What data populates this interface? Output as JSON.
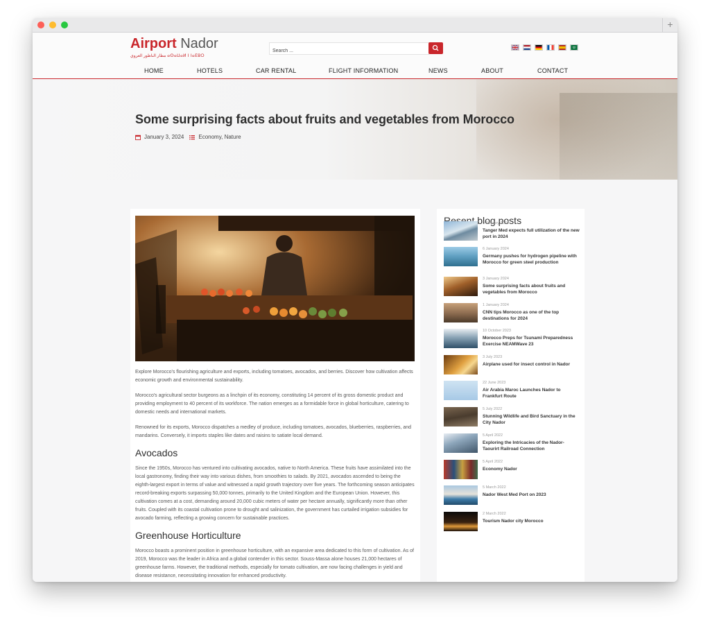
{
  "logo": {
    "part1": "Airport",
    "part2": "Nador",
    "tagline": "مطار الناظور العروي  ⴰⵙⴰⵡⴰⵍ ⵏ ⵏⴰⴹⵓⵔ"
  },
  "search": {
    "placeholder": "Search ..."
  },
  "languages": [
    "English",
    "Dutch",
    "German",
    "French",
    "Spanish",
    "Arabic"
  ],
  "nav": [
    "HOME",
    "HOTELS",
    "CAR RENTAL",
    "FLIGHT INFORMATION",
    "NEWS",
    "ABOUT",
    "CONTACT"
  ],
  "post": {
    "title": "Some surprising facts about fruits and vegetables from Morocco",
    "date": "January 3, 2024",
    "categories": "Economy, Nature",
    "paragraphs": [
      "Explore Morocco's flourishing agriculture and exports, including tomatoes, avocados, and berries. Discover how cultivation affects economic growth and environmental sustainability.",
      "Morocco's agricultural sector burgeons as a linchpin of its economy, constituting 14 percent of its gross domestic product and providing employment to 40 percent of its workforce. The nation emerges as a formidable force in global horticulture, catering to domestic needs and international markets.",
      "Renowned for its exports, Morocco dispatches a medley of produce, including tomatoes, avocados, blueberries, raspberries, and mandarins. Conversely, it imports staples like dates and raisins to satiate local demand."
    ],
    "h_avocados": "Avocados",
    "p_avocados": "Since the 1950s, Morocco has ventured into cultivating avocados, native to North America. These fruits have assimilated into the local gastronomy, finding their way into various dishes, from smoothies to salads. By 2021, avocados ascended to being the eighth-largest export in terms of value and witnessed a rapid growth trajectory over five years. The forthcoming season anticipates record-breaking exports surpassing 50,000 tonnes, primarily to the United Kingdom and the European Union. However, this cultivation comes at a cost, demanding around 20,000 cubic meters of water per hectare annually, significantly more than other fruits. Coupled with its coastal cultivation prone to drought and salinization, the government has curtailed irrigation subsidies for avocado farming, reflecting a growing concern for sustainable practices.",
    "h_greenhouse": "Greenhouse Horticulture",
    "p_greenhouse": "Morocco boasts a prominent position in greenhouse horticulture, with an expansive area dedicated to this form of cultivation. As of 2019, Morocco was the leader in Africa and a global contender in this sector. Souss-Massa alone houses 21,000 hectares of greenhouse farms. However, the traditional methods, especially for tomato cultivation, are now facing challenges in yield and disease resistance, necessitating innovation for enhanced productivity."
  },
  "sidebar": {
    "title": "Resent blog posts",
    "posts": [
      {
        "date": "9 January 2024",
        "title": "Tanger Med expects full utilization of the new port in 2024",
        "thumb": "port"
      },
      {
        "date": "6 January 2024",
        "title": "Germany pushes for hydrogen pipeline with Morocco for green steel production",
        "thumb": "pipeline"
      },
      {
        "date": "3 January 2024",
        "title": "Some surprising facts about fruits and vegetables from Morocco",
        "thumb": "market"
      },
      {
        "date": "1 January 2024",
        "title": "CNN tips Morocco as one of the top destinations for 2024",
        "thumb": "city"
      },
      {
        "date": "10 October 2023",
        "title": "Morocco Preps for Tsunami Preparedness Exercise NEAMWave 23",
        "thumb": "waves"
      },
      {
        "date": "3 July 2023",
        "title": "Airplane used for insect control in Nador",
        "thumb": "plane-gold"
      },
      {
        "date": "22 June 2023",
        "title": "Air Arabia Maroc Launches Nador to Frankfurt Route",
        "thumb": "plane-sky"
      },
      {
        "date": "5 July 2022",
        "title": "Stunning Wildlife and Bird Sanctuary in the City Nador",
        "thumb": "sanctuary"
      },
      {
        "date": "5 April 2022",
        "title": "Exploring the Intricacies of the Nador-Taourirt Railroad Connection",
        "thumb": "train"
      },
      {
        "date": "5 April 2022",
        "title": "Economy Nador",
        "thumb": "containers"
      },
      {
        "date": "5 March 2022",
        "title": "Nador West Med Port on 2023",
        "thumb": "coast"
      },
      {
        "date": "2 March 2022",
        "title": "Tourism Nador city Morocco",
        "thumb": "night"
      }
    ]
  },
  "colors": {
    "accent": "#c9262b",
    "text": "#333333",
    "muted": "#555555"
  }
}
